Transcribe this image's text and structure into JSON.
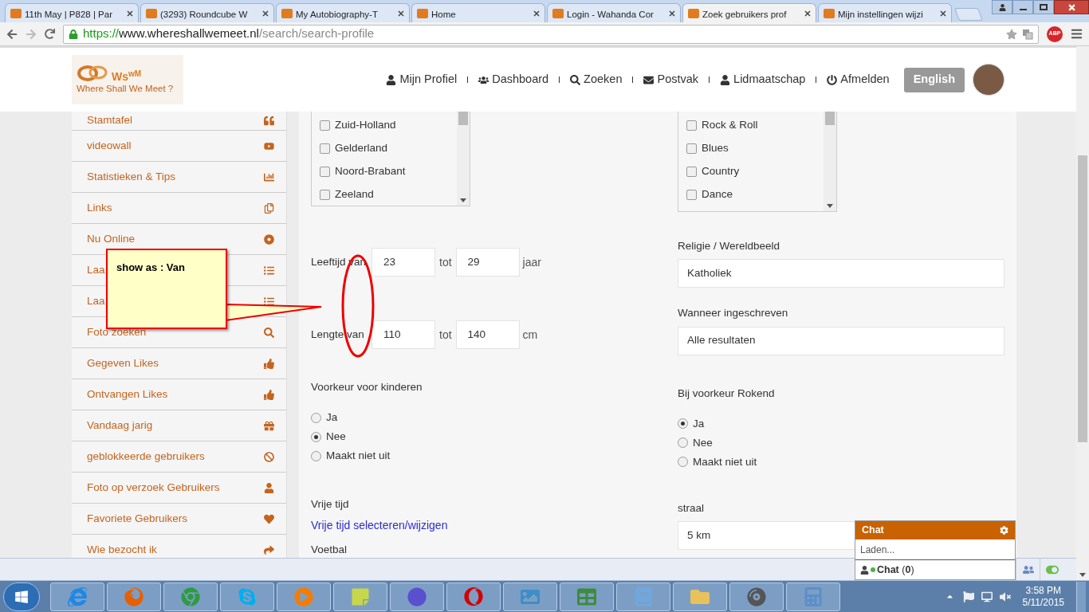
{
  "browser": {
    "tabs": [
      {
        "title": "11th May | P828 | Par",
        "selected": false
      },
      {
        "title": "(3293) Roundcube W",
        "selected": false
      },
      {
        "title": "My Autobiography-T",
        "selected": false
      },
      {
        "title": "Home",
        "selected": false
      },
      {
        "title": "Login - Wahanda Cor",
        "selected": false
      },
      {
        "title": "Zoek gebruikers prof",
        "selected": true
      },
      {
        "title": "Mijn instellingen wijzi",
        "selected": false
      }
    ],
    "address": {
      "scheme": "https://",
      "host": "www.whereshallwemeet.nl",
      "path": "/search/search-profile"
    },
    "extension_badge": "ABP"
  },
  "site": {
    "logo": {
      "mark": "Ws",
      "mark_sup": "wM",
      "tagline": "Where Shall We Meet ?"
    },
    "nav": [
      "Mijn Profiel",
      "Dashboard",
      "Zoeken",
      "Postvak",
      "Lidmaatschap",
      "Afmelden"
    ],
    "language_button": "English"
  },
  "sidebar": [
    "Stamtafel",
    "videowall",
    "Statistieken & Tips",
    "Links",
    "Nu Online",
    "Laa",
    "Laa",
    "Foto zoeken",
    "Gegeven Likes",
    "Ontvangen Likes",
    "Vandaag jarig",
    "geblokkeerde gebruikers",
    "Foto op verzoek Gebruikers",
    "Favoriete Gebruikers",
    "Wie bezocht ik"
  ],
  "provinces": [
    {
      "label": "Zuid-Holland",
      "checked": false
    },
    {
      "label": "Gelderland",
      "checked": false
    },
    {
      "label": "Noord-Brabant",
      "checked": false
    },
    {
      "label": "Zeeland",
      "checked": false
    }
  ],
  "music": [
    {
      "label": "Rock & Roll",
      "checked": false
    },
    {
      "label": "Blues",
      "checked": false
    },
    {
      "label": "Country",
      "checked": false
    },
    {
      "label": "Dance",
      "checked": false
    }
  ],
  "ranges": [
    {
      "label": "Leeftijd van",
      "from": "23",
      "to_label": "tot",
      "to": "29",
      "unit": "jaar"
    },
    {
      "label": "Lengte van",
      "from": "110",
      "to_label": "tot",
      "to": "140",
      "unit": "cm"
    }
  ],
  "children_pref": {
    "label": "Voorkeur voor kinderen",
    "options": [
      {
        "label": "Ja",
        "selected": false
      },
      {
        "label": "Nee",
        "selected": true
      },
      {
        "label": "Maakt niet uit",
        "selected": false
      }
    ]
  },
  "free_time": {
    "label": "Vrije tijd",
    "link": "Vrije tijd selecteren/wijzigen",
    "next_label": "Voetbal"
  },
  "religion": {
    "label": "Religie / Wereldbeeld",
    "value": "Katholiek"
  },
  "registered": {
    "label": "Wanneer ingeschreven",
    "value": "Alle resultaten"
  },
  "smoking": {
    "label": "Bij voorkeur Rokend",
    "options": [
      {
        "label": "Ja",
        "selected": true
      },
      {
        "label": "Nee",
        "selected": false
      },
      {
        "label": "Maakt niet uit",
        "selected": false
      }
    ]
  },
  "radius": {
    "label": "straal",
    "value": "5 km"
  },
  "annotation": {
    "callout": "show as : Van"
  },
  "chat": {
    "title": "Chat",
    "status": "Laden...",
    "footer": "**Chat** (**0**)"
  },
  "clock": {
    "time": "3:58 PM",
    "date": "5/11/2015"
  }
}
